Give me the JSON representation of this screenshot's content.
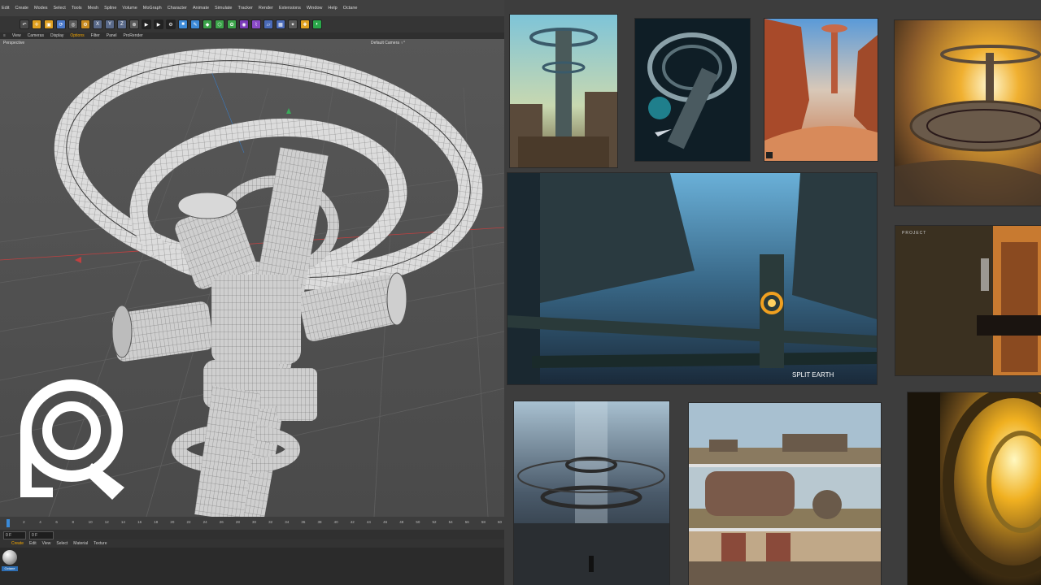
{
  "app": {
    "menu_items": [
      "Edit",
      "Create",
      "Modes",
      "Select",
      "Tools",
      "Mesh",
      "Spline",
      "Volume",
      "MoGraph",
      "Character",
      "Animate",
      "Simulate",
      "Tracker",
      "Render",
      "Extensions",
      "Window",
      "Help",
      "Octane"
    ],
    "viewport_menu": [
      "View",
      "Cameras",
      "Display",
      "Options",
      "Filter",
      "Panel",
      "ProRender"
    ],
    "viewport_name": "Perspective",
    "camera_name": "Default Camera ♀°",
    "timeline_ticks": [
      "0",
      "2",
      "4",
      "6",
      "8",
      "10",
      "12",
      "14",
      "16",
      "18",
      "20",
      "22",
      "24",
      "26",
      "28",
      "30",
      "32",
      "34",
      "36",
      "38",
      "40",
      "42",
      "44",
      "46",
      "48",
      "50",
      "52",
      "54",
      "56",
      "58",
      "60"
    ],
    "current_frame": "0 F",
    "start_frame": "0 F",
    "material_menu": [
      "Create",
      "Edit",
      "View",
      "Select",
      "Material",
      "Texture"
    ],
    "material_name": "Octane"
  },
  "toolbar_icons": [
    "undo-icon",
    "move-icon",
    "scale-icon",
    "rotate-icon",
    "live-select-icon",
    "last-tool-icon",
    "x-axis-icon",
    "y-axis-icon",
    "z-axis-icon",
    "world-coord-icon",
    "render-view-icon",
    "render-picture-icon",
    "render-settings-icon",
    "cube-icon",
    "pen-icon",
    "subdivide-icon",
    "array-icon",
    "cloner-icon",
    "field-icon",
    "deformer-icon",
    "floor-icon",
    "camera-icon",
    "light-icon",
    "tag-icon",
    "octane-icon"
  ],
  "toolbar_labels": {
    "x": "X",
    "y": "Y",
    "z": "Z"
  },
  "gallery": {
    "watermark": "SPLIT EARTH",
    "poster_text": "PROJECT",
    "art_names": [
      "sci-fi-city-tower",
      "spaceship-ring-station",
      "desert-canyon-tower",
      "floating-ring-city-sunset",
      "industrial-city-bridges",
      "robot-building-corridor",
      "circular-hall-rings",
      "desert-vehicle-panels",
      "golden-tunnel"
    ]
  },
  "colors": {
    "accent": "#f6a800",
    "viewport_bg": "#525252",
    "gallery_bg": "#3d3d3d",
    "logo": "#ffffff"
  }
}
